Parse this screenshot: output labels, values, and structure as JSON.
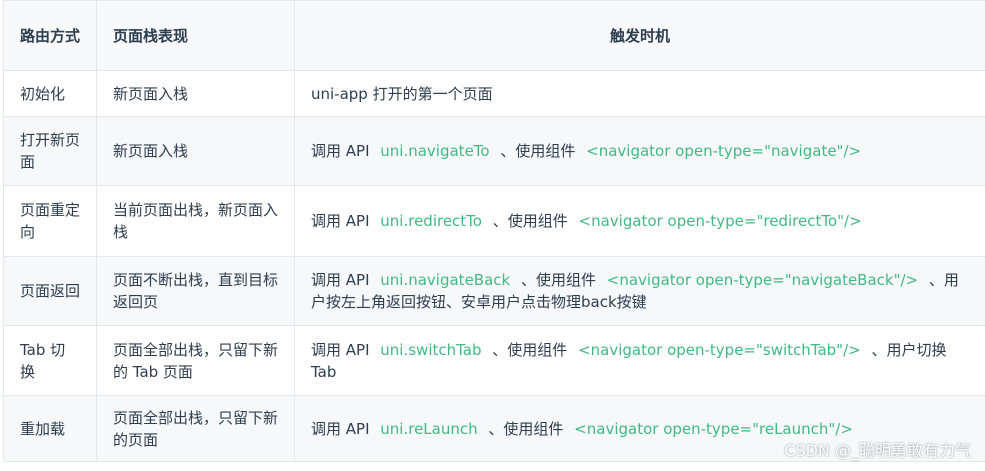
{
  "table": {
    "headers": [
      "路由方式",
      "页面栈表现",
      "触发时机"
    ],
    "rows": [
      {
        "method": "初始化",
        "stack": "新页面入栈",
        "trigger": [
          {
            "type": "text",
            "text": "uni-app 打开的第一个页面"
          }
        ]
      },
      {
        "method": "打开新页面",
        "stack": "新页面入栈",
        "trigger": [
          {
            "type": "text",
            "text": "调用 API "
          },
          {
            "type": "code",
            "text": "uni.navigateTo"
          },
          {
            "type": "text",
            "text": " 、使用组件 "
          },
          {
            "type": "code",
            "text": "<navigator open-type=\"navigate\"/>"
          }
        ]
      },
      {
        "method": "页面重定向",
        "stack": "当前页面出栈，新页面入栈",
        "trigger": [
          {
            "type": "text",
            "text": "调用 API "
          },
          {
            "type": "code",
            "text": "uni.redirectTo"
          },
          {
            "type": "text",
            "text": " 、使用组件 "
          },
          {
            "type": "code",
            "text": "<navigator open-type=\"redirectTo\"/>"
          }
        ]
      },
      {
        "method": "页面返回",
        "stack": "页面不断出栈，直到目标返回页",
        "trigger": [
          {
            "type": "text",
            "text": "调用 API "
          },
          {
            "type": "code",
            "text": "uni.navigateBack"
          },
          {
            "type": "text",
            "text": " 、使用组件 "
          },
          {
            "type": "code",
            "text": "<navigator open-type=\"navigateBack\"/>"
          },
          {
            "type": "text",
            "text": " 、用户按左上角返回按钮、安卓用户点击物理back按键"
          }
        ]
      },
      {
        "method": "Tab 切换",
        "stack": "页面全部出栈，只留下新的 Tab 页面",
        "trigger": [
          {
            "type": "text",
            "text": "调用 API "
          },
          {
            "type": "code",
            "text": "uni.switchTab"
          },
          {
            "type": "text",
            "text": " 、使用组件 "
          },
          {
            "type": "code",
            "text": "<navigator open-type=\"switchTab\"/>"
          },
          {
            "type": "text",
            "text": " 、用户切换 Tab"
          }
        ]
      },
      {
        "method": "重加载",
        "stack": "页面全部出栈，只留下新的页面",
        "trigger": [
          {
            "type": "text",
            "text": "调用 API "
          },
          {
            "type": "code",
            "text": "uni.reLaunch"
          },
          {
            "type": "text",
            "text": " 、使用组件 "
          },
          {
            "type": "code",
            "text": "<navigator open-type=\"reLaunch\"/>"
          }
        ]
      }
    ]
  },
  "watermark": "CSDN @_聪明勇敢有力气",
  "colors": {
    "code": "#42b983",
    "text": "#2c3e50",
    "border": "#e4e8ec",
    "stripe": "#f6f8fa"
  }
}
